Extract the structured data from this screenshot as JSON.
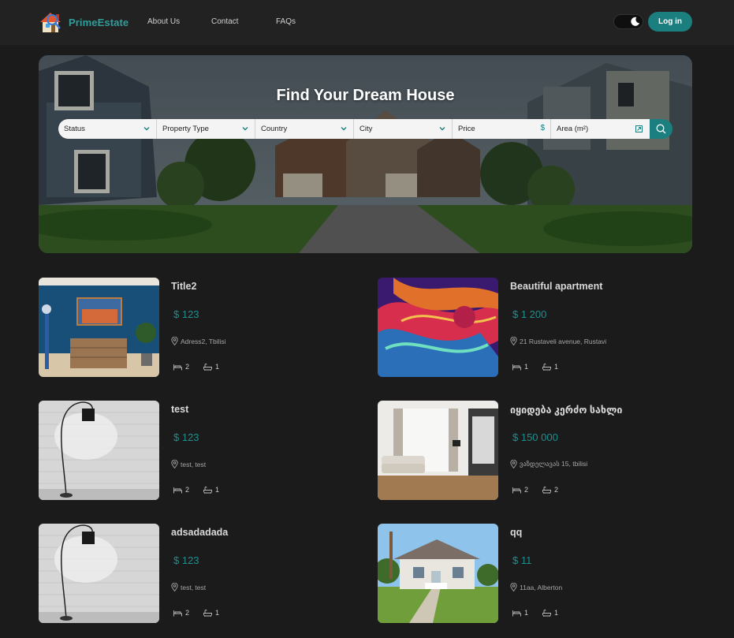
{
  "brand": {
    "name": "PrimeEstate",
    "accent": "#1b7f80"
  },
  "nav": {
    "links": [
      "About Us",
      "Contact",
      "FAQs"
    ],
    "login_label": "Log in",
    "theme_icon": "moon-icon"
  },
  "hero": {
    "title": "Find Your Dream House",
    "filters": {
      "status": "Status",
      "property_type": "Property Type",
      "country": "Country",
      "city": "City",
      "price": "Price",
      "price_symbol": "$",
      "area": "Area (m²)"
    }
  },
  "listings": [
    {
      "title": "Title2",
      "price": "$ 123",
      "address": "Adress2, Tbilisi",
      "beds": "2",
      "baths": "1"
    },
    {
      "title": "Beautiful apartment",
      "price": "$ 1 200",
      "address": "21 Rustaveli avenue, Rustavi",
      "beds": "1",
      "baths": "1"
    },
    {
      "title": "test",
      "price": "$ 123",
      "address": "test, test",
      "beds": "2",
      "baths": "1"
    },
    {
      "title": "იყიდება კერძო სახლი",
      "price": "$ 150 000",
      "address": "ვაზდელავას 15, tbilisi",
      "beds": "2",
      "baths": "2"
    },
    {
      "title": "adsadadada",
      "price": "$ 123",
      "address": "test, test",
      "beds": "2",
      "baths": "1"
    },
    {
      "title": "qq",
      "price": "$ 11",
      "address": "11aa, Alberton",
      "beds": "1",
      "baths": "1"
    }
  ]
}
